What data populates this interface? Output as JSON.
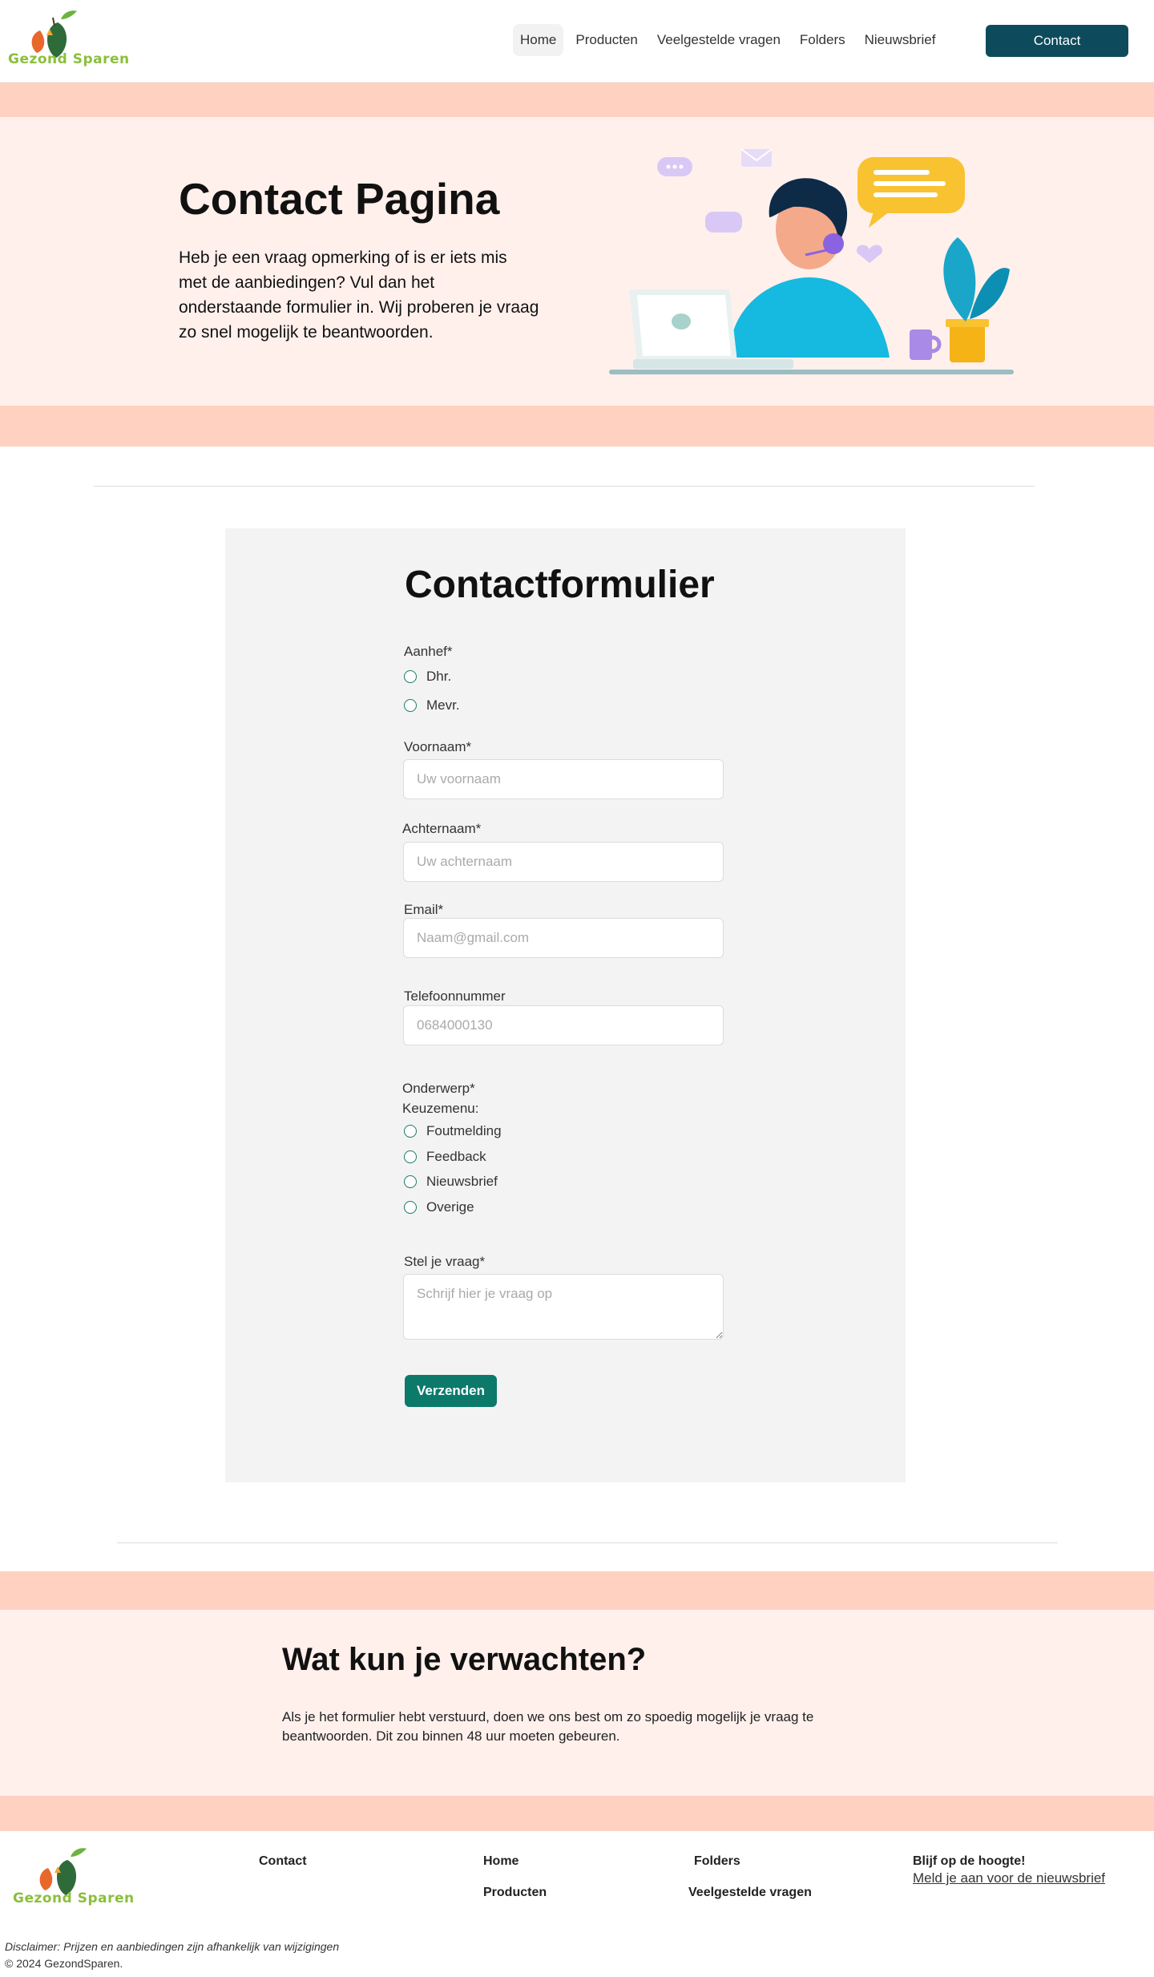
{
  "header": {
    "logo_text": "Gezond Sparen",
    "nav": [
      "Home",
      "Producten",
      "Veelgestelde vragen",
      "Folders",
      "Nieuwsbrief"
    ],
    "contact_button": "Contact"
  },
  "hero": {
    "title": "Contact Pagina",
    "text": "Heb je een vraag opmerking of is er iets mis met de aanbiedingen? Vul dan het onderstaande formulier in. Wij proberen je vraag zo snel mogelijk te beantwoorden."
  },
  "form": {
    "title": "Contactformulier",
    "salutation_label": "Aanhef*",
    "salutation_options": [
      "Dhr.",
      "Mevr."
    ],
    "firstname_label": "Voornaam*",
    "firstname_placeholder": "Uw voornaam",
    "lastname_label": "Achternaam*",
    "lastname_placeholder": "Uw achternaam",
    "email_label": "Email*",
    "email_placeholder": "Naam@gmail.com",
    "phone_label": "Telefoonnummer",
    "phone_placeholder": "0684000130",
    "subject_label": "Onderwerp*",
    "subject_sublabel": "Keuzemenu:",
    "subject_options": [
      "Foutmelding",
      "Feedback",
      "Nieuwsbrief",
      "Overige"
    ],
    "question_label": "Stel je vraag*",
    "question_placeholder": "Schrijf hier je vraag op",
    "submit_label": "Verzenden"
  },
  "expect": {
    "title": "Wat kun je verwachten?",
    "text": "Als je het formulier  hebt verstuurd, doen we ons best om zo spoedig mogelijk je vraag te beantwoorden. Dit zou binnen 48 uur moeten gebeuren."
  },
  "footer": {
    "logo_text": "Gezond Sparen",
    "links": {
      "contact": "Contact",
      "home": "Home",
      "producten": "Producten",
      "folders": "Folders",
      "faq": "Veelgestelde vragen"
    },
    "newsletter_title": "Blijf op de hoogte!",
    "newsletter_link": "Meld je aan voor de nieuwsbrief",
    "disclaimer": "Disclaimer: Prijzen en aanbiedingen zijn afhankelijk van wijzigingen",
    "copyright": "© 2024 GezondSparen."
  },
  "colors": {
    "brand_dark": "#0d4b5c",
    "brand_green": "#0c7a6a",
    "peach_band": "#ffd1c0",
    "peach_light": "#fff0ec"
  }
}
